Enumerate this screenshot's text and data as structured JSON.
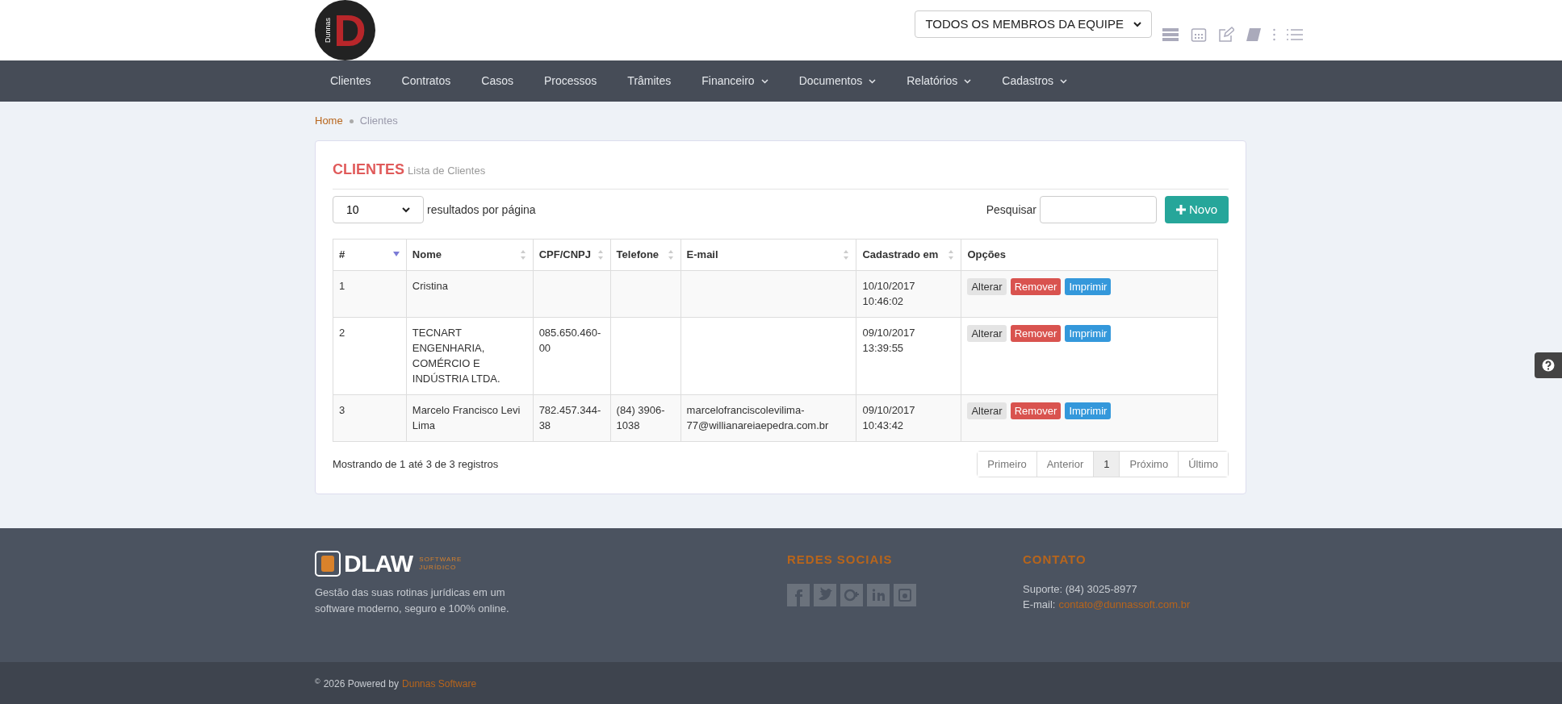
{
  "header": {
    "logo": {
      "letter": "D",
      "brand": "Dunnas"
    },
    "team_select": "TODOS OS MEMBROS DA EQUIPE"
  },
  "nav": [
    {
      "label": "Clientes",
      "dropdown": false
    },
    {
      "label": "Contratos",
      "dropdown": false
    },
    {
      "label": "Casos",
      "dropdown": false
    },
    {
      "label": "Processos",
      "dropdown": false
    },
    {
      "label": "Trâmites",
      "dropdown": false
    },
    {
      "label": "Financeiro",
      "dropdown": true
    },
    {
      "label": "Documentos",
      "dropdown": true
    },
    {
      "label": "Relatórios",
      "dropdown": true
    },
    {
      "label": "Cadastros",
      "dropdown": true
    }
  ],
  "breadcrumb": [
    "Home",
    "Clientes"
  ],
  "card": {
    "title": "CLIENTES",
    "subtitle": "Lista de Clientes",
    "page_size": "10",
    "page_size_label": "resultados por página",
    "search_label": "Pesquisar",
    "new_button": "Novo"
  },
  "table": {
    "columns": [
      {
        "label": "#",
        "sortable": true,
        "sorted": true
      },
      {
        "label": "Nome",
        "sortable": true,
        "sorted": false
      },
      {
        "label": "CPF/CNPJ",
        "sortable": true,
        "sorted": false
      },
      {
        "label": "Telefone",
        "sortable": true,
        "sorted": false
      },
      {
        "label": "E-mail",
        "sortable": true,
        "sorted": false
      },
      {
        "label": "Cadastrado em",
        "sortable": true,
        "sorted": false
      },
      {
        "label": "Opções",
        "sortable": false
      }
    ],
    "rows": [
      {
        "cells": [
          "1",
          "Cristina",
          "",
          "",
          "",
          "10/10/2017 10:46:02"
        ],
        "actions": [
          {
            "label": "Alterar",
            "kind": "default"
          },
          {
            "label": "Remover",
            "kind": "danger"
          },
          {
            "label": "Imprimir",
            "kind": "primary"
          }
        ]
      },
      {
        "cells": [
          "2",
          "TECNART ENGENHARIA, COMÉRCIO E INDÚSTRIA LTDA.",
          "085.650.460-00",
          "",
          "",
          "09/10/2017 13:39:55"
        ],
        "actions": [
          {
            "label": "Alterar",
            "kind": "default"
          },
          {
            "label": "Remover",
            "kind": "danger"
          },
          {
            "label": "Imprimir",
            "kind": "primary"
          }
        ]
      },
      {
        "cells": [
          "3",
          "Marcelo Francisco Levi Lima",
          "782.457.344-38",
          "(84) 3906-1038",
          "marcelofranciscolevilima-77@willianareiaepedra.com.br",
          "09/10/2017 10:43:42"
        ],
        "actions": [
          {
            "label": "Alterar",
            "kind": "default"
          },
          {
            "label": "Remover",
            "kind": "danger"
          },
          {
            "label": "Imprimir",
            "kind": "primary"
          }
        ]
      }
    ]
  },
  "info": "Mostrando de 1 até 3 de 3 registros",
  "pagination": [
    {
      "label": "Primeiro",
      "selected": false
    },
    {
      "label": "Anterior",
      "selected": false
    },
    {
      "label": "1",
      "selected": true
    },
    {
      "label": "Próximo",
      "selected": false
    },
    {
      "label": "Último",
      "selected": false
    }
  ],
  "footer": {
    "brand": "DLAW",
    "brand_tag": [
      "SOFTWARE",
      "JURÍDICO"
    ],
    "description": "Gestão das suas rotinas jurídicas em um software moderno, seguro e 100% online.",
    "social_title": "REDES SOCIAIS",
    "contact_title": "CONTATO",
    "support": "Suporte: (84) 3025-8977",
    "email_label": "E-mail:",
    "email": "contato@dunnassoft.com.br",
    "copyright_mark": "©",
    "copyright": "2026 Powered by",
    "company": "Dunnas Software"
  }
}
